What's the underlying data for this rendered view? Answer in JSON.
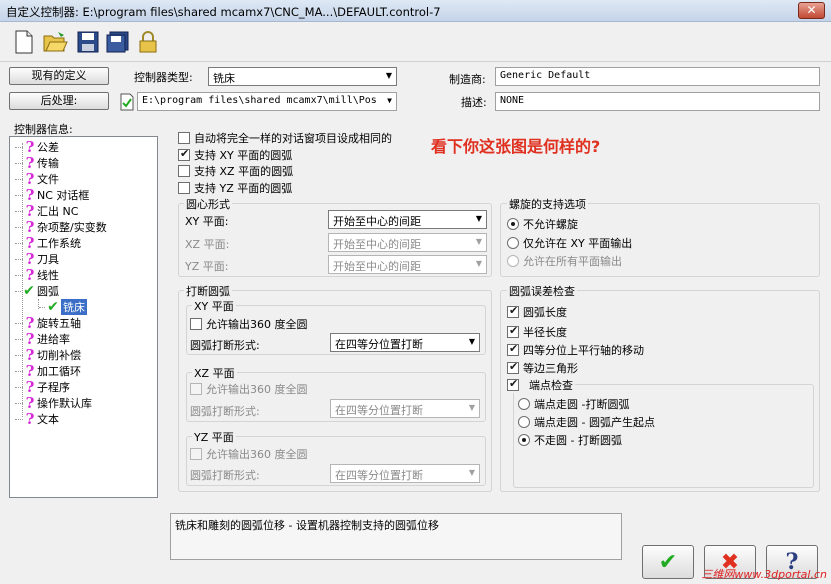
{
  "window": {
    "title": "自定义控制器: E:\\program files\\shared mcamx7\\CNC_MA...\\DEFAULT.control-7",
    "close_glyph": "✕"
  },
  "toolbar": {
    "icons": [
      "new-file-icon",
      "open-folder-icon",
      "save-icon",
      "save-as-icon",
      "lock-icon"
    ]
  },
  "top": {
    "existing_defs_button": "现有的定义",
    "post_button": "后处理:",
    "controller_type_label": "控制器类型:",
    "controller_type_value": "铣床",
    "post_path_value": "E:\\program files\\shared mcamx7\\mill\\Pos",
    "manufacturer_label": "制造商:",
    "manufacturer_value": "Generic Default",
    "description_label": "描述:",
    "description_value": "NONE"
  },
  "tree": {
    "label": "控制器信息:",
    "items": [
      {
        "label": "公差",
        "state": "unknown"
      },
      {
        "label": "传输",
        "state": "unknown"
      },
      {
        "label": "文件",
        "state": "unknown"
      },
      {
        "label": "NC 对话框",
        "state": "unknown"
      },
      {
        "label": "汇出 NC",
        "state": "unknown"
      },
      {
        "label": "杂项整/实变数",
        "state": "unknown"
      },
      {
        "label": "工作系统",
        "state": "unknown"
      },
      {
        "label": "刀具",
        "state": "unknown"
      },
      {
        "label": "线性",
        "state": "unknown"
      },
      {
        "label": "圆弧",
        "state": "checked"
      },
      {
        "label": "铣床",
        "state": "checked-selected"
      },
      {
        "label": "旋转五轴",
        "state": "unknown"
      },
      {
        "label": "进给率",
        "state": "unknown"
      },
      {
        "label": "切削补偿",
        "state": "unknown"
      },
      {
        "label": "加工循环",
        "state": "unknown"
      },
      {
        "label": "子程序",
        "state": "unknown"
      },
      {
        "label": "操作默认库",
        "state": "unknown"
      },
      {
        "label": "文本",
        "state": "unknown"
      }
    ]
  },
  "options": {
    "auto_same": {
      "label": "自动将完全一样的对话窗项目设成相同的",
      "checked": false
    },
    "xy_arc": {
      "label": "支持 XY 平面的圆弧",
      "checked": true
    },
    "xz_arc": {
      "label": "支持 XZ 平面的圆弧",
      "checked": false
    },
    "yz_arc": {
      "label": "支持 YZ 平面的圆弧",
      "checked": false
    }
  },
  "annotation": "看下你这张图是何样的?",
  "center_form": {
    "title": "圆心形式",
    "xy_label": "XY 平面:",
    "xy_value": "开始至中心的间距",
    "xz_label": "XZ 平面:",
    "xz_value": "开始至中心的间距",
    "yz_label": "YZ 平面:",
    "yz_value": "开始至中心的间距"
  },
  "break_arc": {
    "title": "打断圆弧",
    "xy": {
      "title": "XY 平面",
      "allow360": "允许输出360 度全圆",
      "form_label": "圆弧打断形式:",
      "form_value": "在四等分位置打断"
    },
    "xz": {
      "title": "XZ 平面",
      "allow360": "允许输出360 度全圆",
      "form_label": "圆弧打断形式:",
      "form_value": "在四等分位置打断"
    },
    "yz": {
      "title": "YZ 平面",
      "allow360": "允许输出360 度全圆",
      "form_label": "圆弧打断形式:",
      "form_value": "在四等分位置打断"
    }
  },
  "helix": {
    "title": "螺旋的支持选项",
    "opt1": "不允许螺旋",
    "opt2": "仅允许在 XY 平面输出",
    "opt3": "允许在所有平面输出",
    "selected": 0
  },
  "arc_check": {
    "title": "圆弧误差检查",
    "arc_length": "圆弧长度",
    "radius_length": "半径长度",
    "quadrant_move": "四等分位上平行轴的移动",
    "equilateral": "等边三角形",
    "endpoint_check": "端点检查",
    "ep1": "端点走圆 -打断圆弧",
    "ep2": "端点走圆 - 圆弧产生起点",
    "ep3": "不走圆 - 打断圆弧",
    "selected": 2
  },
  "description_box": "铣床和雕刻的圆弧位移 - 设置机器控制支持的圆弧位移",
  "bottom_buttons": {
    "ok_glyph": "✔",
    "cancel_glyph": "✖",
    "help_glyph": "?"
  },
  "watermark": "三维网www.3dportal.cn",
  "colors": {
    "question_mark": "#d82bd8",
    "check_mark": "#22aa22",
    "annotation": "#e03020"
  }
}
